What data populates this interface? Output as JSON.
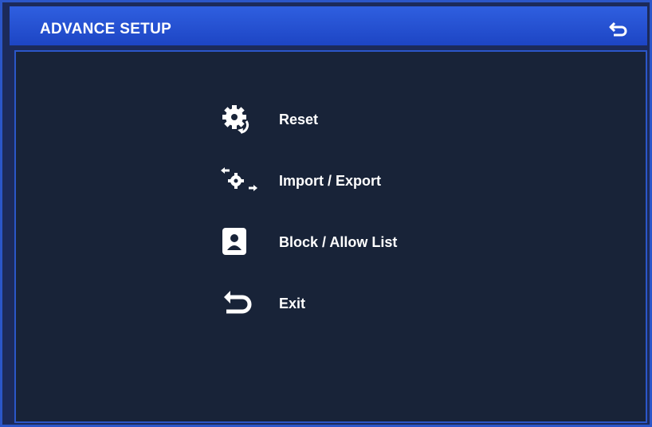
{
  "header": {
    "title": "ADVANCE SETUP",
    "back_icon": "return-arrow-icon"
  },
  "menu": {
    "items": [
      {
        "label": "Reset",
        "icon": "gear-reset-icon"
      },
      {
        "label": "Import / Export",
        "icon": "gear-transfer-icon"
      },
      {
        "label": "Block / Allow List",
        "icon": "user-badge-icon"
      },
      {
        "label": "Exit",
        "icon": "return-arrow-icon"
      }
    ]
  },
  "colors": {
    "title_bar": "#2f5fe0",
    "border": "#2b56c9",
    "panel_bg": "#182338",
    "text": "#ffffff"
  }
}
